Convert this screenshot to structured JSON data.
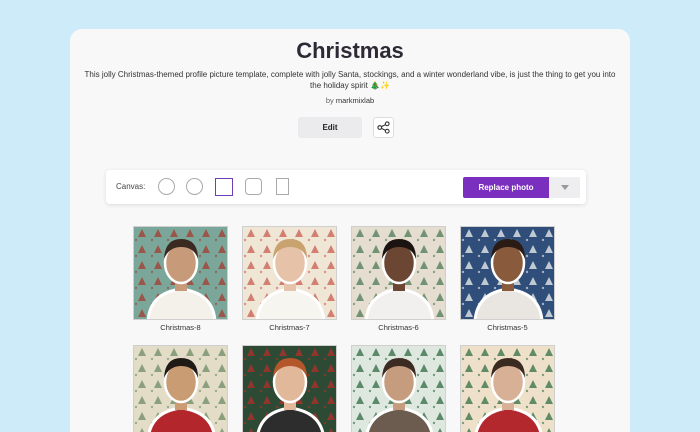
{
  "page": {
    "title": "Christmas",
    "description": "This jolly Christmas-themed profile picture template, complete with jolly Santa, stockings, and a winter wonderland vibe, is just the thing to get you into the holiday spirit 🎄✨",
    "author_prefix": "by",
    "author": "markmixlab",
    "edit_label": "Edit"
  },
  "toolbar": {
    "canvas_label": "Canvas:",
    "replace_label": "Replace photo"
  },
  "thumbnails": [
    {
      "caption": "Christmas-8",
      "bg": "#7aa79a",
      "pattern": "#a23a2e",
      "skin": "#c79a7a",
      "hair": "#3b2a22",
      "shirt": "#f4f1ea"
    },
    {
      "caption": "Christmas-7",
      "bg": "#efe6d6",
      "pattern": "#c85a4f",
      "skin": "#e6c2a8",
      "hair": "#c9a36f",
      "shirt": "#f7f5f0"
    },
    {
      "caption": "Christmas-6",
      "bg": "#e5ddd0",
      "pattern": "#4b7a55",
      "skin": "#6b4632",
      "hair": "#1c1410",
      "shirt": "#f2f0ee"
    },
    {
      "caption": "Christmas-5",
      "bg": "#2f4f7a",
      "pattern": "#f0f0f0",
      "skin": "#8a5a3c",
      "hair": "#2a1c14",
      "shirt": "#e9e6e2"
    },
    {
      "caption": "",
      "bg": "#e3ddc8",
      "pattern": "#6f8a64",
      "skin": "#c99c74",
      "hair": "#1f1a16",
      "shirt": "#b3262c"
    },
    {
      "caption": "",
      "bg": "#2c4a34",
      "pattern": "#b22f2a",
      "skin": "#e2b89b",
      "hair": "#b4572b",
      "shirt": "#2d2d2d"
    },
    {
      "caption": "",
      "bg": "#dfe8de",
      "pattern": "#2f6b44",
      "skin": "#c69c7e",
      "hair": "#3c2b22",
      "shirt": "#6b5c4f"
    },
    {
      "caption": "",
      "bg": "#efe1c9",
      "pattern": "#2f6e45",
      "skin": "#d8b096",
      "hair": "#3a2a20",
      "shirt": "#b2282d"
    }
  ]
}
